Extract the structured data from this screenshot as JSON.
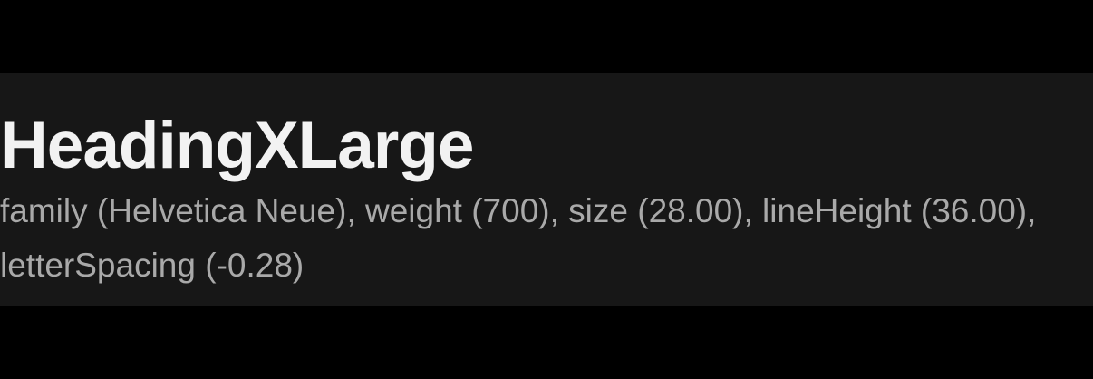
{
  "token": {
    "name": "HeadingXLarge",
    "description": "family (Helvetica Neue), weight (700), size (28.00), lineHeight (36.00), letterSpacing (-0.28)"
  },
  "colors": {
    "page_background": "#000000",
    "panel_background": "#171717",
    "heading_text": "#f2f2f2",
    "description_text": "#a9a9a9"
  }
}
